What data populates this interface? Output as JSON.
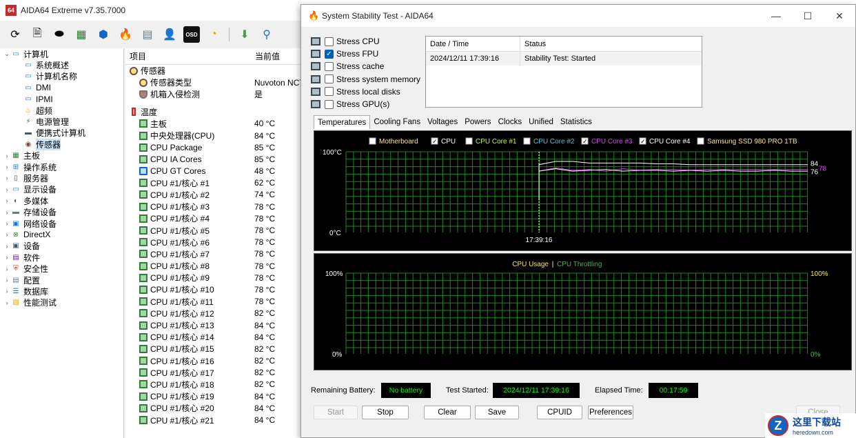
{
  "main": {
    "app_icon": "64",
    "title": "AIDA64 Extreme v7.35.7000"
  },
  "toolbar": {
    "icons": [
      "refresh-icon",
      "report-icon",
      "motherboard-icon",
      "memory-icon",
      "network-icon",
      "flame-icon",
      "benchmark-icon",
      "user-icon",
      "osd-icon",
      "gauge-icon",
      "download-icon",
      "search-icon"
    ],
    "osd_label": "OSD"
  },
  "tree": {
    "root": "计算机",
    "root_children": [
      "系统概述",
      "计算机名称",
      "DMI",
      "IPMI",
      "超频",
      "电源管理",
      "便携式计算机",
      "传感器"
    ],
    "items": [
      "主板",
      "操作系统",
      "服务器",
      "显示设备",
      "多媒体",
      "存储设备",
      "网络设备",
      "DirectX",
      "设备",
      "软件",
      "安全性",
      "配置",
      "数据库",
      "性能测试"
    ]
  },
  "list": {
    "header_item": "项目",
    "header_value": "当前值",
    "sensor_group": "传感器",
    "sensor_rows": [
      {
        "label": "传感器类型",
        "value": "Nuvoton NCT"
      },
      {
        "label": "机箱入侵检测",
        "value": "是"
      }
    ],
    "temp_group": "温度",
    "temp_rows": [
      {
        "label": "主板",
        "value": "40 °C"
      },
      {
        "label": "中央处理器(CPU)",
        "value": "84 °C"
      },
      {
        "label": "CPU Package",
        "value": "85 °C"
      },
      {
        "label": "CPU IA Cores",
        "value": "85 °C"
      },
      {
        "label": "CPU GT Cores",
        "value": "48 °C"
      },
      {
        "label": "CPU #1/核心 #1",
        "value": "62 °C"
      },
      {
        "label": "CPU #1/核心 #2",
        "value": "74 °C"
      },
      {
        "label": "CPU #1/核心 #3",
        "value": "78 °C"
      },
      {
        "label": "CPU #1/核心 #4",
        "value": "78 °C"
      },
      {
        "label": "CPU #1/核心 #5",
        "value": "78 °C"
      },
      {
        "label": "CPU #1/核心 #6",
        "value": "78 °C"
      },
      {
        "label": "CPU #1/核心 #7",
        "value": "78 °C"
      },
      {
        "label": "CPU #1/核心 #8",
        "value": "78 °C"
      },
      {
        "label": "CPU #1/核心 #9",
        "value": "78 °C"
      },
      {
        "label": "CPU #1/核心 #10",
        "value": "78 °C"
      },
      {
        "label": "CPU #1/核心 #11",
        "value": "78 °C"
      },
      {
        "label": "CPU #1/核心 #12",
        "value": "82 °C"
      },
      {
        "label": "CPU #1/核心 #13",
        "value": "84 °C"
      },
      {
        "label": "CPU #1/核心 #14",
        "value": "84 °C"
      },
      {
        "label": "CPU #1/核心 #15",
        "value": "82 °C"
      },
      {
        "label": "CPU #1/核心 #16",
        "value": "82 °C"
      },
      {
        "label": "CPU #1/核心 #17",
        "value": "82 °C"
      },
      {
        "label": "CPU #1/核心 #18",
        "value": "82 °C"
      },
      {
        "label": "CPU #1/核心 #19",
        "value": "84 °C"
      },
      {
        "label": "CPU #1/核心 #20",
        "value": "84 °C"
      },
      {
        "label": "CPU #1/核心 #21",
        "value": "84 °C"
      }
    ]
  },
  "dialog": {
    "title": "System Stability Test - AIDA64",
    "minimize": "—",
    "maximize": "☐",
    "close": "✕",
    "stress": [
      {
        "label": "Stress CPU",
        "checked": false
      },
      {
        "label": "Stress FPU",
        "checked": true
      },
      {
        "label": "Stress cache",
        "checked": false
      },
      {
        "label": "Stress system memory",
        "checked": false
      },
      {
        "label": "Stress local disks",
        "checked": false
      },
      {
        "label": "Stress GPU(s)",
        "checked": false
      }
    ],
    "status_table": {
      "col_date": "Date / Time",
      "col_status": "Status",
      "rows": [
        {
          "date": "2024/12/11 17:39:16",
          "status": "Stability Test: Started"
        }
      ]
    },
    "tabs": [
      "Temperatures",
      "Cooling Fans",
      "Voltages",
      "Powers",
      "Clocks",
      "Unified",
      "Statistics"
    ],
    "bottom": {
      "battery_label": "Remaining Battery:",
      "battery_value": "No battery",
      "started_label": "Test Started:",
      "started_value": "2024/12/11 17:39:16",
      "elapsed_label": "Elapsed Time:",
      "elapsed_value": "00:17:59"
    },
    "buttons": {
      "start": "Start",
      "stop": "Stop",
      "clear": "Clear",
      "save": "Save",
      "cpuid": "CPUID",
      "preferences": "Preferences",
      "close": "Close"
    }
  },
  "chart_data": [
    {
      "type": "line",
      "legend": [
        {
          "name": "Motherboard",
          "checked": false,
          "color": "#ffe57f"
        },
        {
          "name": "CPU",
          "checked": true,
          "color": "#ffffff"
        },
        {
          "name": "CPU Core #1",
          "checked": false,
          "color": "#c6ff00"
        },
        {
          "name": "CPU Core #2",
          "checked": false,
          "color": "#4fc3f7"
        },
        {
          "name": "CPU Core #3",
          "checked": true,
          "color": "#e040fb"
        },
        {
          "name": "CPU Core #4",
          "checked": true,
          "color": "#ffffff"
        },
        {
          "name": "Samsung SSD 980 PRO 1TB",
          "checked": false,
          "color": "#ffe57f"
        }
      ],
      "ylim": [
        0,
        100
      ],
      "y_top_label": "100°C",
      "y_bottom_label": "0°C",
      "x_marker_label": "17:39:16",
      "end_labels": [
        "84",
        "76",
        "78"
      ],
      "series": [
        {
          "name": "CPU",
          "color": "#ffffff",
          "values": [
            84,
            88,
            88,
            86,
            86,
            86,
            86,
            85,
            85,
            84,
            84,
            84,
            84,
            84,
            84,
            84,
            84
          ]
        },
        {
          "name": "CPU Core #3",
          "color": "#e040fb",
          "values": [
            76,
            80,
            77,
            78,
            76,
            79,
            77,
            78,
            78,
            77,
            78,
            78,
            78,
            78,
            78,
            78,
            78
          ]
        },
        {
          "name": "CPU Core #4",
          "color": "#ffffff",
          "values": [
            76,
            79,
            76,
            77,
            78,
            76,
            77,
            77,
            76,
            77,
            76,
            77,
            76,
            76,
            77,
            76,
            76
          ]
        }
      ],
      "grid": true
    },
    {
      "type": "line",
      "title_left": "CPU Usage",
      "title_sep": "|",
      "title_right": "CPU Throttling",
      "ylim": [
        0,
        100
      ],
      "y_top_label_left": "100%",
      "y_bottom_label_left": "0%",
      "y_top_label_right": "100%",
      "y_bottom_label_right": "0%",
      "series": [],
      "grid": true
    }
  ]
}
